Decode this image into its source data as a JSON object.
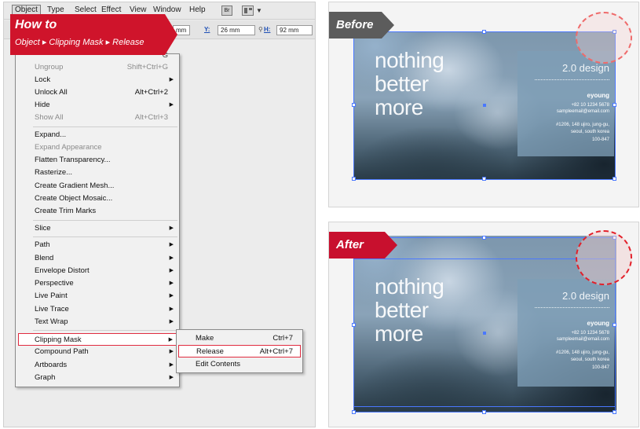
{
  "menubar": {
    "items": [
      "Object",
      "Type",
      "Select",
      "Effect",
      "View",
      "Window",
      "Help"
    ],
    "bridge_label": "Br"
  },
  "controlbar": {
    "w_partial": "mm",
    "y_label": "Y:",
    "y_value": "26 mm",
    "h_label": "H:",
    "h_value": "92 mm"
  },
  "callout": {
    "title": "How to",
    "path": "Object ▸ Clipping Mask ▸ Release"
  },
  "object_menu": {
    "partial_top_shortcut": "G",
    "items": [
      {
        "label": "Ungroup",
        "shortcut": "Shift+Ctrl+G",
        "disabled": true
      },
      {
        "label": "Lock",
        "submenu": true
      },
      {
        "label": "Unlock All",
        "shortcut": "Alt+Ctrl+2"
      },
      {
        "label": "Hide",
        "submenu": true
      },
      {
        "label": "Show All",
        "shortcut": "Alt+Ctrl+3",
        "disabled": true
      },
      {
        "label": "Expand..."
      },
      {
        "label": "Expand Appearance",
        "disabled": true
      },
      {
        "label": "Flatten Transparency..."
      },
      {
        "label": "Rasterize..."
      },
      {
        "label": "Create Gradient Mesh..."
      },
      {
        "label": "Create Object Mosaic..."
      },
      {
        "label": "Create Trim Marks"
      },
      {
        "label": "Slice",
        "submenu": true
      },
      {
        "label": "Path",
        "submenu": true
      },
      {
        "label": "Blend",
        "submenu": true
      },
      {
        "label": "Envelope Distort",
        "submenu": true
      },
      {
        "label": "Perspective",
        "submenu": true
      },
      {
        "label": "Live Paint",
        "submenu": true
      },
      {
        "label": "Live Trace",
        "submenu": true
      },
      {
        "label": "Text Wrap",
        "submenu": true
      },
      {
        "label": "Clipping Mask",
        "submenu": true,
        "highlighted": true
      },
      {
        "label": "Compound Path",
        "submenu": true
      },
      {
        "label": "Artboards",
        "submenu": true
      },
      {
        "label": "Graph",
        "submenu": true
      }
    ]
  },
  "clipping_submenu": {
    "items": [
      {
        "label": "Make",
        "shortcut": "Ctrl+7"
      },
      {
        "label": "Release",
        "shortcut": "Alt+Ctrl+7",
        "highlighted": true
      },
      {
        "label": "Edit Contents",
        "shortcut": ""
      }
    ]
  },
  "before": {
    "tag": "Before"
  },
  "after": {
    "tag": "After"
  },
  "card": {
    "headline": "nothing\nbetter\nmore",
    "design": "2.0 design",
    "name": "eyoung",
    "phone": "+82 10 1234 5678",
    "email": "sampleemail@email.com",
    "address_1": "#1206, 148 ujiro, jung-gu,",
    "address_2": "seoul, south korea",
    "address_3": "100-847"
  },
  "colors": {
    "accent_red": "#cf142b",
    "before_tag": "#5c5c5c",
    "selection_blue": "#4a78ff"
  }
}
